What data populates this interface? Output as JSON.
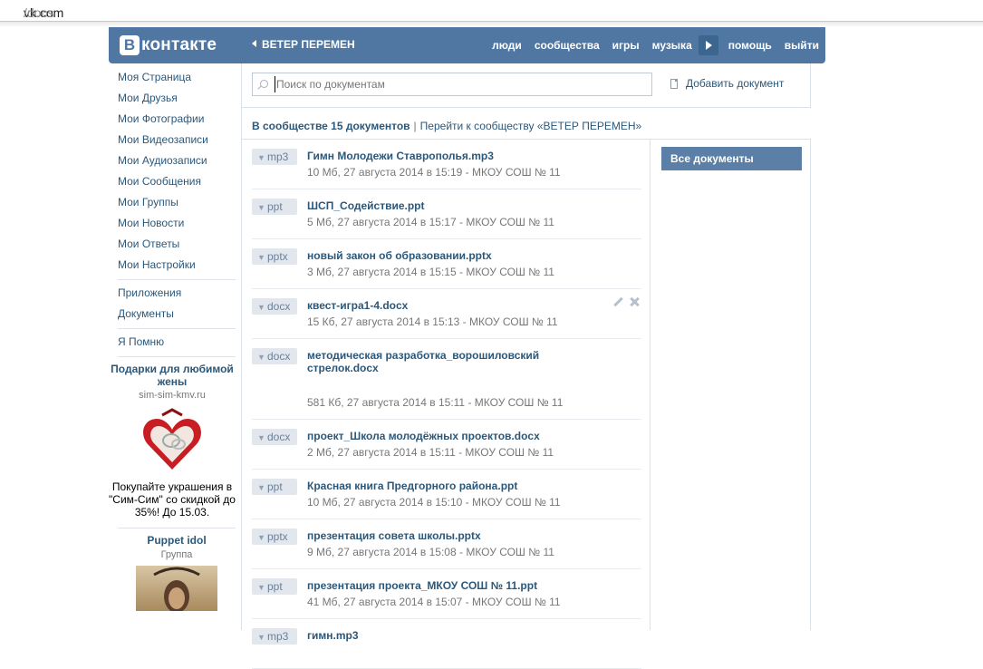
{
  "browser": {
    "url_host": "vk.com",
    "url_path": "/docs"
  },
  "header": {
    "logo_letter": "B",
    "logo_text": "контакте",
    "group_back": "ВЕТЕР ПЕРЕМЕН",
    "nav": [
      "люди",
      "сообщества",
      "игры",
      "музыка",
      "помощь",
      "выйти"
    ]
  },
  "sidebar": {
    "items": [
      "Моя Страница",
      "Мои Друзья",
      "Мои Фотографии",
      "Мои Видеозаписи",
      "Мои Аудиозаписи",
      "Мои Сообщения",
      "Мои Группы",
      "Мои Новости",
      "Мои Ответы",
      "Мои Настройки"
    ],
    "apps": "Приложения",
    "docs": "Документы",
    "remember": "Я Помню",
    "ad": {
      "title": "Подарки для любимой жены",
      "domain": "sim-sim-kmv.ru",
      "text": "Покупайте украшения в \"Сим-Сим\" со скидкой до 35%! До 15.03."
    },
    "group_ad": {
      "title": "Puppet idol",
      "subtitle": "Группа"
    }
  },
  "search": {
    "placeholder": "Поиск по документам",
    "value": ""
  },
  "add_document": "Добавить документ",
  "summary": {
    "count": "В сообществе 15 документов",
    "link": "Перейти к сообществу «ВЕТЕР ПЕРЕМЕН»"
  },
  "filter": {
    "active": "Все документы"
  },
  "documents": [
    {
      "ext": "mp3",
      "name": "Гимн Молодежи Ставрополья.mp3",
      "meta": "10 Мб, 27 августа 2014 в 15:19 - МКОУ СОШ № 11"
    },
    {
      "ext": "ppt",
      "name": "ШСП_Содействие.ppt",
      "meta": "5 Мб, 27 августа 2014 в 15:17 - МКОУ СОШ № 11"
    },
    {
      "ext": "pptx",
      "name": "новый закон об образовании.pptx",
      "meta": "3 Мб, 27 августа 2014 в 15:15 - МКОУ СОШ № 11"
    },
    {
      "ext": "docx",
      "name": "квест-игра1-4.docx",
      "meta": "15 Кб, 27 августа 2014 в 15:13 - МКОУ СОШ № 11"
    },
    {
      "ext": "docx",
      "name": "методическая разработка_ворошиловский стрелок.docx",
      "meta": "581 Кб, 27 августа 2014 в 15:11 - МКОУ СОШ № 11"
    },
    {
      "ext": "docx",
      "name": "проект_Школа молодёжных проектов.docx",
      "meta": "2 Мб, 27 августа 2014 в 15:11 - МКОУ СОШ № 11"
    },
    {
      "ext": "ppt",
      "name": "Красная книга Предгорного района.ppt",
      "meta": "10 Мб, 27 августа 2014 в 15:10 - МКОУ СОШ № 11"
    },
    {
      "ext": "pptx",
      "name": "презентация совета школы.pptx",
      "meta": "9 Мб, 27 августа 2014 в 15:08 - МКОУ СОШ № 11"
    },
    {
      "ext": "ppt",
      "name": "презентация проекта_МКОУ СОШ № 11.ppt",
      "meta": "41 Мб, 27 августа 2014 в 15:07 - МКОУ СОШ № 11"
    },
    {
      "ext": "mp3",
      "name": "гимн.mp3",
      "meta": ""
    }
  ]
}
